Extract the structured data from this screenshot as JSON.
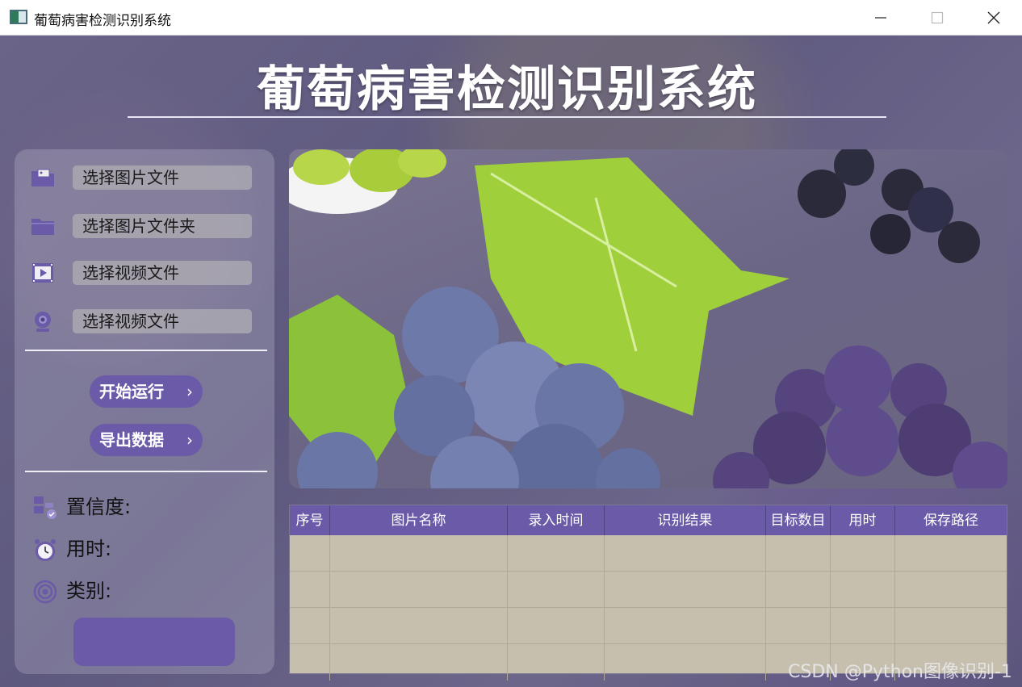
{
  "window": {
    "title": "葡萄病害检测识别系统",
    "minimize": "—",
    "maximize": "☐",
    "close": "✕"
  },
  "header": {
    "title": "葡萄病害检测识别系统"
  },
  "menu": [
    {
      "label": "选择图片文件",
      "icon": "image-folder-icon"
    },
    {
      "label": "选择图片文件夹",
      "icon": "folder-icon"
    },
    {
      "label": "选择视频文件",
      "icon": "video-file-icon"
    },
    {
      "label": "选择视频文件",
      "icon": "webcam-icon"
    }
  ],
  "actions": {
    "run": "开始运行",
    "export": "导出数据",
    "chevron": "›"
  },
  "info": {
    "confidence": "置信度:",
    "time": "用时:",
    "category": "类别:"
  },
  "table": {
    "columns": [
      "序号",
      "图片名称",
      "录入时间",
      "识别结果",
      "目标数目",
      "用时",
      "保存路径"
    ],
    "rows": [
      [
        "",
        "",
        "",
        "",
        "",
        "",
        ""
      ],
      [
        "",
        "",
        "",
        "",
        "",
        "",
        ""
      ],
      [
        "",
        "",
        "",
        "",
        "",
        "",
        ""
      ],
      [
        "",
        "",
        "",
        "",
        "",
        "",
        ""
      ]
    ]
  },
  "watermark": "CSDN @Python图像识别-1",
  "colors": {
    "accent": "#6a5aa8",
    "table_body": "#c6bfad",
    "panel_bg": "#6f6a8a"
  }
}
